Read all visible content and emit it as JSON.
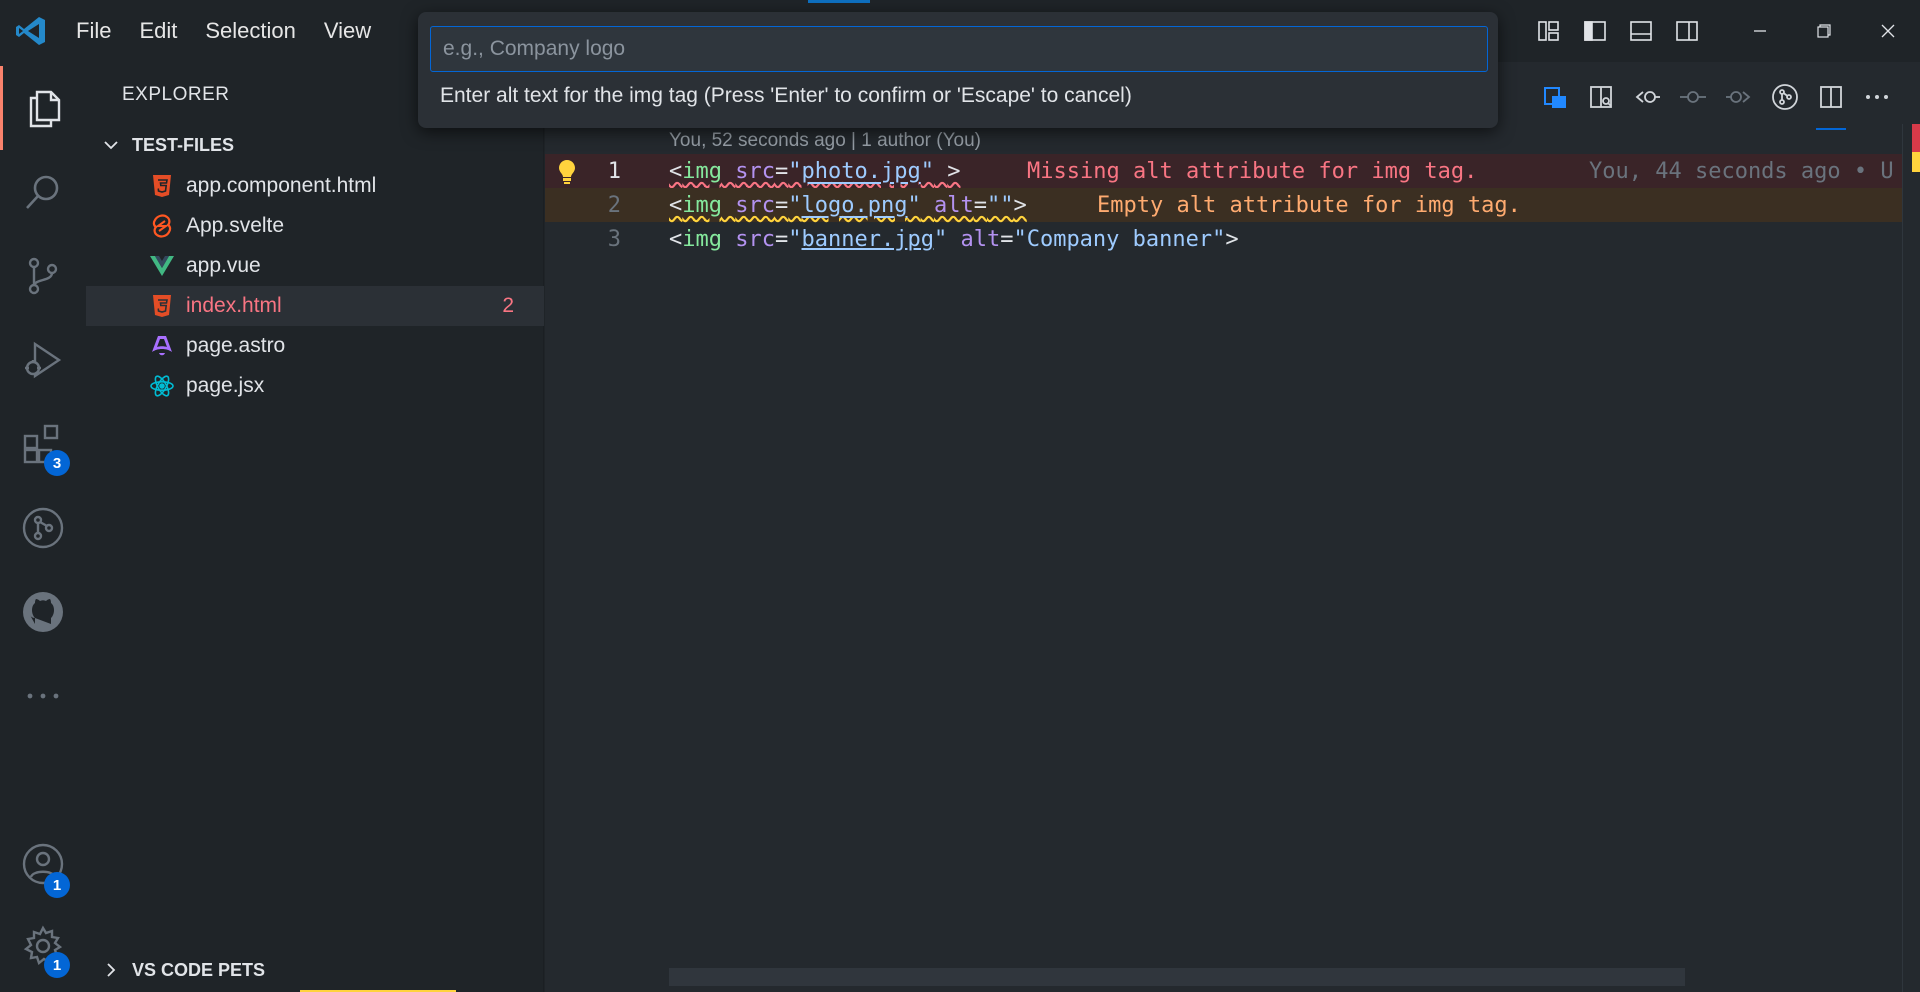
{
  "menu": {
    "file": "File",
    "edit": "Edit",
    "selection": "Selection",
    "view": "View"
  },
  "quick_input": {
    "placeholder": "e.g., Company logo",
    "value": "",
    "message": "Enter alt text for the img tag (Press 'Enter' to confirm or 'Escape' to cancel)"
  },
  "activity": {
    "extensions_badge": "3",
    "accounts_badge": "1",
    "settings_badge": "1"
  },
  "sidebar": {
    "title": "EXPLORER",
    "folder": "TEST-FILES",
    "files": [
      {
        "name": "app.component.html",
        "icon": "html-icon"
      },
      {
        "name": "App.svelte",
        "icon": "svelte-icon"
      },
      {
        "name": "app.vue",
        "icon": "vue-icon"
      },
      {
        "name": "index.html",
        "icon": "html-icon",
        "problems": "2"
      },
      {
        "name": "page.astro",
        "icon": "astro-icon"
      },
      {
        "name": "page.jsx",
        "icon": "react-icon"
      }
    ],
    "pets_section": "VS CODE PETS"
  },
  "editor": {
    "blame_header": "You, 52 seconds ago | 1 author (You)",
    "lines": [
      {
        "number": "1",
        "diagnostic": "Missing alt attribute for img tag.",
        "inline_blame": "You, 44 seconds ago • U"
      },
      {
        "number": "2",
        "diagnostic": "Empty alt attribute for img tag."
      },
      {
        "number": "3"
      }
    ],
    "code": {
      "l1_src": "photo.jpg",
      "l2_src": "logo.png",
      "l3_src": "banner.jpg",
      "l3_alt": "Company banner"
    }
  },
  "colors": {
    "accent": "#0366d6",
    "error": "#f97583",
    "warning": "#ffab70",
    "tag": "#85e89d",
    "attr": "#b392f0",
    "string": "#9ecbff"
  }
}
